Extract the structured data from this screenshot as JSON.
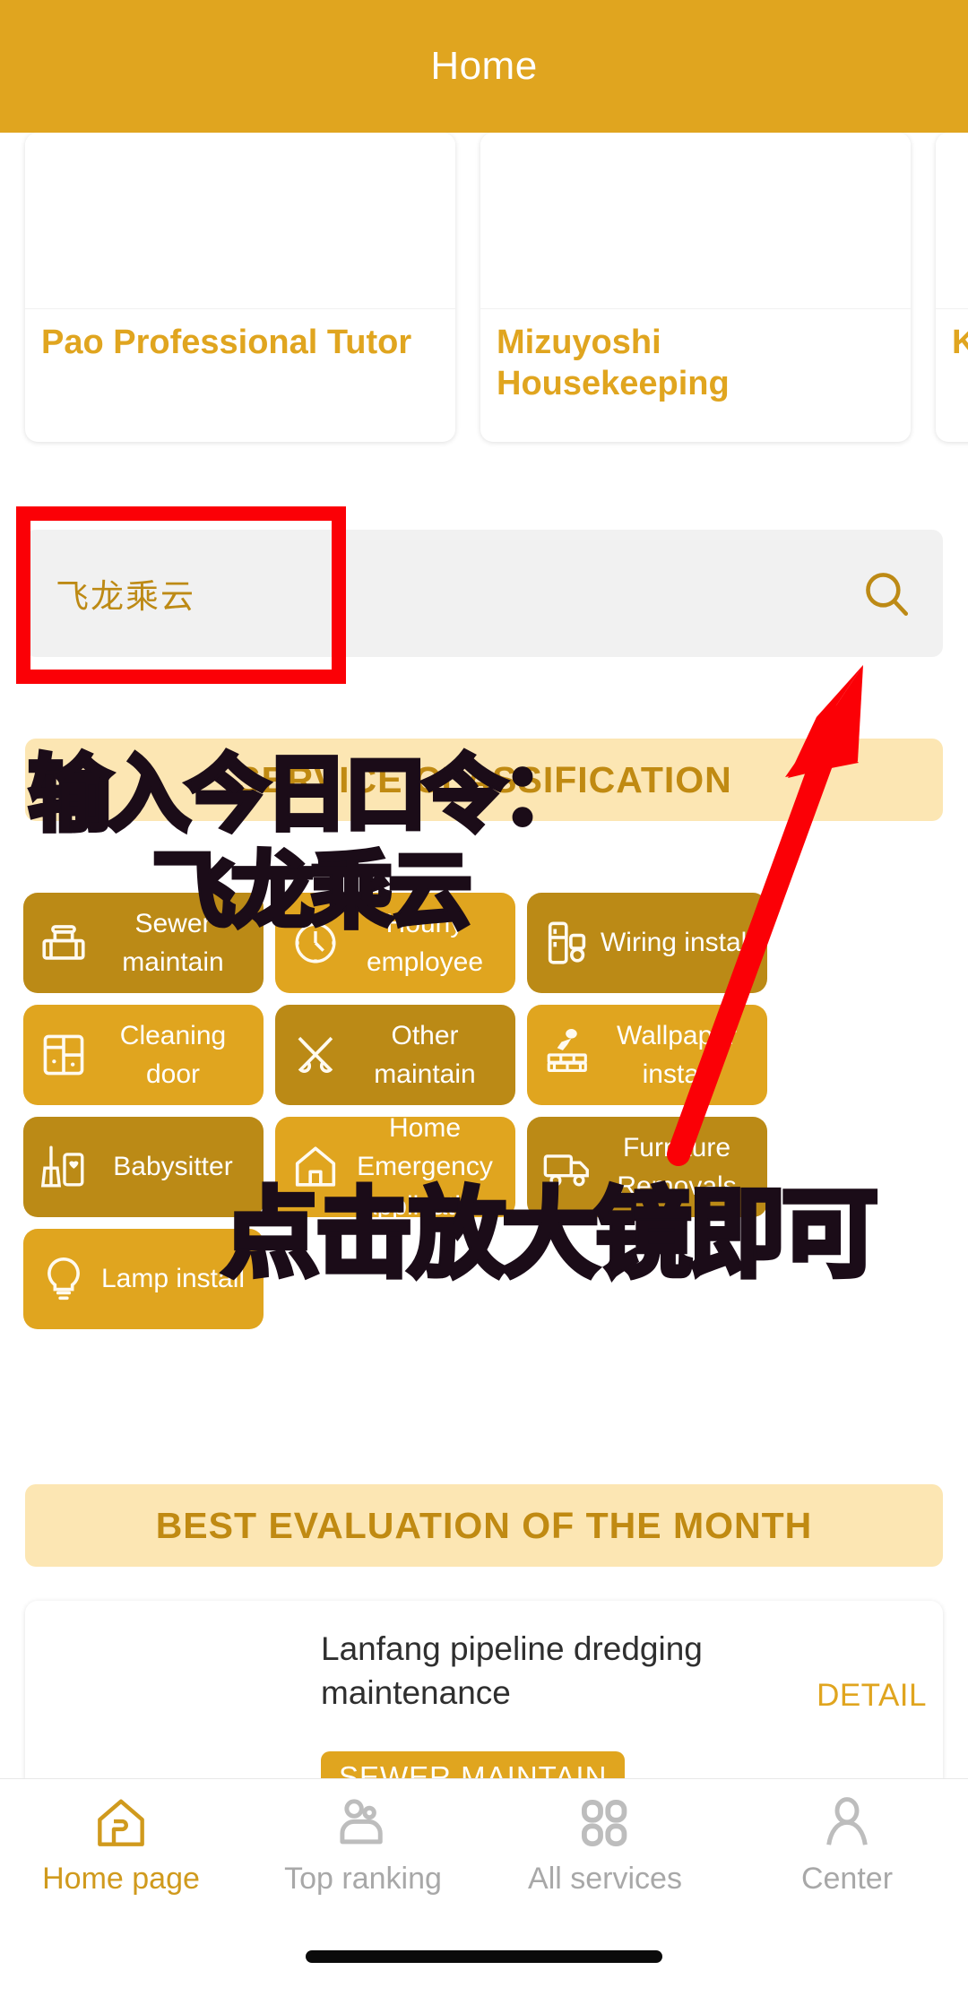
{
  "header": {
    "title": "Home"
  },
  "shops": [
    {
      "name": "Pao Professional Tutor"
    },
    {
      "name": "Mizuyoshi Housekeeping"
    },
    {
      "name": "K H"
    }
  ],
  "search": {
    "value": "飞龙乘云",
    "icon": "search-icon"
  },
  "sections": {
    "services_banner": "SERVICE CLASSIFICATION",
    "evaluation_banner": "BEST EVALUATION OF THE MONTH"
  },
  "services": [
    {
      "label": "Sewer maintain",
      "icon": "pipe-icon",
      "shade": "dark"
    },
    {
      "label": "Hourly employee",
      "icon": "clock-icon",
      "shade": "light"
    },
    {
      "label": "Wiring install",
      "icon": "refrigerator-icon",
      "shade": "dark"
    },
    {
      "label": "Cleaning door",
      "icon": "window-icon",
      "shade": "light"
    },
    {
      "label": "Other maintain",
      "icon": "tools-icon",
      "shade": "dark"
    },
    {
      "label": "Wallpaper install",
      "icon": "bricks-icon",
      "shade": "light"
    },
    {
      "label": "Babysitter",
      "icon": "broom-icon",
      "shade": "dark"
    },
    {
      "label": "Home Emergency Application",
      "icon": "home-icon",
      "shade": "light"
    },
    {
      "label": "Furniture Removals",
      "icon": "truck-icon",
      "shade": "dark"
    },
    {
      "label": "Lamp install",
      "icon": "bulb-icon",
      "shade": "light"
    }
  ],
  "evaluation": {
    "title": "Lanfang pipeline dredging maintenance",
    "detail_label": "DETAIL",
    "tag": "SEWER MAINTAIN"
  },
  "tabbar": [
    {
      "label": "Home page",
      "icon": "house-icon",
      "active": true
    },
    {
      "label": "Top ranking",
      "icon": "ranking-icon",
      "active": false
    },
    {
      "label": "All services",
      "icon": "grid-icon",
      "active": false
    },
    {
      "label": "Center",
      "icon": "person-icon",
      "active": false
    }
  ],
  "annotations": {
    "line1": "输入今日口令：",
    "line2": "飞龙乘云",
    "line3": "点击放大镜即可",
    "box_color": "#fb0006",
    "arrow_color": "#fb0006"
  },
  "colors": {
    "brand": "#e0a51f",
    "brand_dark": "#bb8a16",
    "banner_bg": "#fce6b3",
    "banner_text": "#c08a12",
    "search_bg": "#f1f1f1"
  }
}
